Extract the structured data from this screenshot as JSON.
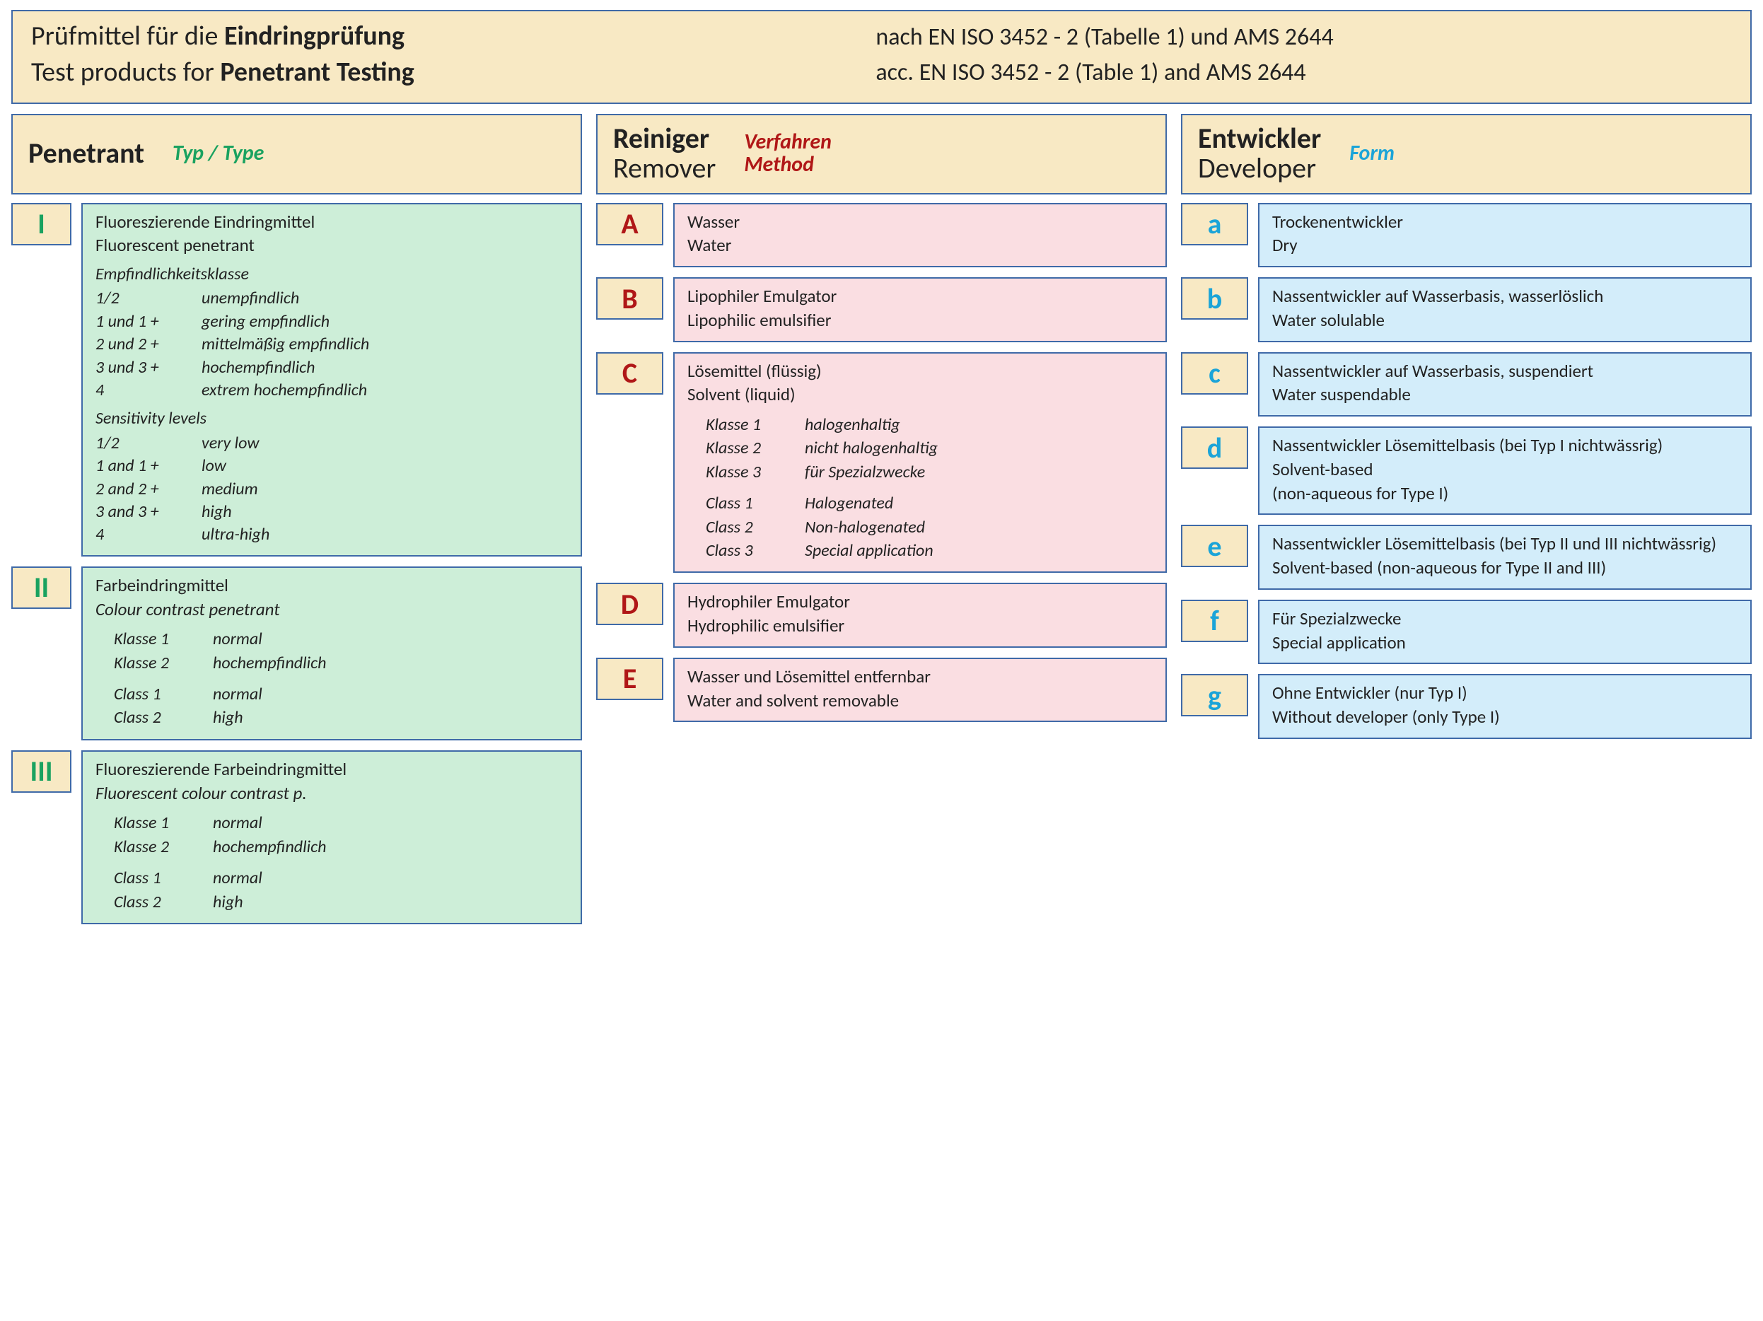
{
  "header": {
    "de_prefix": "Prüfmittel für die ",
    "de_bold": "Eindringprüfung",
    "en_prefix": "Test products for ",
    "en_bold": "Penetrant Testing",
    "right_de": "nach  EN ISO 3452 - 2 (Tabelle 1)  und  AMS 2644",
    "right_en": "acc.  EN ISO 3452 - 2 (Table 1)  and  AMS 2644"
  },
  "sections": {
    "penetrant": {
      "title": "Penetrant",
      "sub": "Typ / Type"
    },
    "remover": {
      "title_de": "Reiniger",
      "title_en": "Remover",
      "sub_de": "Verfahren",
      "sub_en": "Method"
    },
    "developer": {
      "title_de": "Entwickler",
      "title_en": "Developer",
      "sub": "Form"
    }
  },
  "penetrant": [
    {
      "code": "I",
      "de": "Fluoreszierende Eindringmittel",
      "en": "Fluorescent penetrant",
      "sens": {
        "head_de": "Empfindlichkeitsklasse",
        "rows_de": [
          {
            "k": "1/2",
            "v": "unempfindlich"
          },
          {
            "k": "1 und 1 +",
            "v": "gering empfindlich"
          },
          {
            "k": "2 und 2 +",
            "v": "mittelmäßig empfindlich"
          },
          {
            "k": "3 und 3 +",
            "v": "hochempfindlich"
          },
          {
            "k": "4",
            "v": "extrem hochempfindlich"
          }
        ],
        "head_en": "Sensitivity levels",
        "rows_en": [
          {
            "k": "1/2",
            "v": "very low"
          },
          {
            "k": "1 and 1 +",
            "v": "low"
          },
          {
            "k": "2 and 2 +",
            "v": "medium"
          },
          {
            "k": "3 and 3 +",
            "v": "high"
          },
          {
            "k": "4",
            "v": "ultra-high"
          }
        ]
      }
    },
    {
      "code": "II",
      "de": "Farbeindringmittel",
      "en": "Colour contrast penetrant",
      "classes": {
        "de": [
          {
            "k": "Klasse 1",
            "v": "normal"
          },
          {
            "k": "Klasse 2",
            "v": "hochempfindlich"
          }
        ],
        "en": [
          {
            "k": "Class 1",
            "v": "normal"
          },
          {
            "k": "Class 2",
            "v": "high"
          }
        ]
      }
    },
    {
      "code": "III",
      "de": "Fluoreszierende Farbeindringmittel",
      "en": "Fluorescent colour contrast p.",
      "classes": {
        "de": [
          {
            "k": "Klasse 1",
            "v": "normal"
          },
          {
            "k": "Klasse 2",
            "v": "hochempfindlich"
          }
        ],
        "en": [
          {
            "k": "Class 1",
            "v": "normal"
          },
          {
            "k": "Class 2",
            "v": "high"
          }
        ]
      }
    }
  ],
  "remover": [
    {
      "code": "A",
      "de": "Wasser",
      "en": "Water"
    },
    {
      "code": "B",
      "de": "Lipophiler Emulgator",
      "en": "Lipophilic emulsifier"
    },
    {
      "code": "C",
      "de": "Lösemittel (flüssig)",
      "en": "Solvent (liquid)",
      "classes": {
        "de": [
          {
            "k": "Klasse 1",
            "v": "halogenhaltig"
          },
          {
            "k": "Klasse 2",
            "v": "nicht halogenhaltig"
          },
          {
            "k": "Klasse 3",
            "v": "für Spezialzwecke"
          }
        ],
        "en": [
          {
            "k": "Class 1",
            "v": "Halogenated"
          },
          {
            "k": "Class 2",
            "v": "Non-halogenated"
          },
          {
            "k": "Class 3",
            "v": "Special application"
          }
        ]
      }
    },
    {
      "code": "D",
      "de": "Hydrophiler Emulgator",
      "en": "Hydrophilic emulsifier"
    },
    {
      "code": "E",
      "de": "Wasser und Lösemittel entfernbar",
      "en": "Water and solvent removable"
    }
  ],
  "developer": [
    {
      "code": "a",
      "de": "Trockenentwickler",
      "en": "Dry"
    },
    {
      "code": "b",
      "de": "Nassentwickler auf Wasserbasis, wasserlöslich",
      "en": "Water solulable"
    },
    {
      "code": "c",
      "de": "Nassentwickler auf Wasserbasis, suspendiert",
      "en": "Water suspendable"
    },
    {
      "code": "d",
      "de": "Nassentwickler Lösemittelbasis (bei Typ I nichtwässrig)",
      "en": "Solvent-based",
      "en2": "(non-aqueous for Type I)"
    },
    {
      "code": "e",
      "de": "Nassentwickler Lösemittelbasis (bei Typ II und III nichtwässrig)",
      "en": "Solvent-based  (non-aqueous for Type  II and III)"
    },
    {
      "code": "f",
      "de": "Für Spezialzwecke",
      "en": "Special application"
    },
    {
      "code": "g",
      "de": "Ohne Entwickler (nur Typ I)",
      "en": "Without developer (only Type I)"
    }
  ]
}
